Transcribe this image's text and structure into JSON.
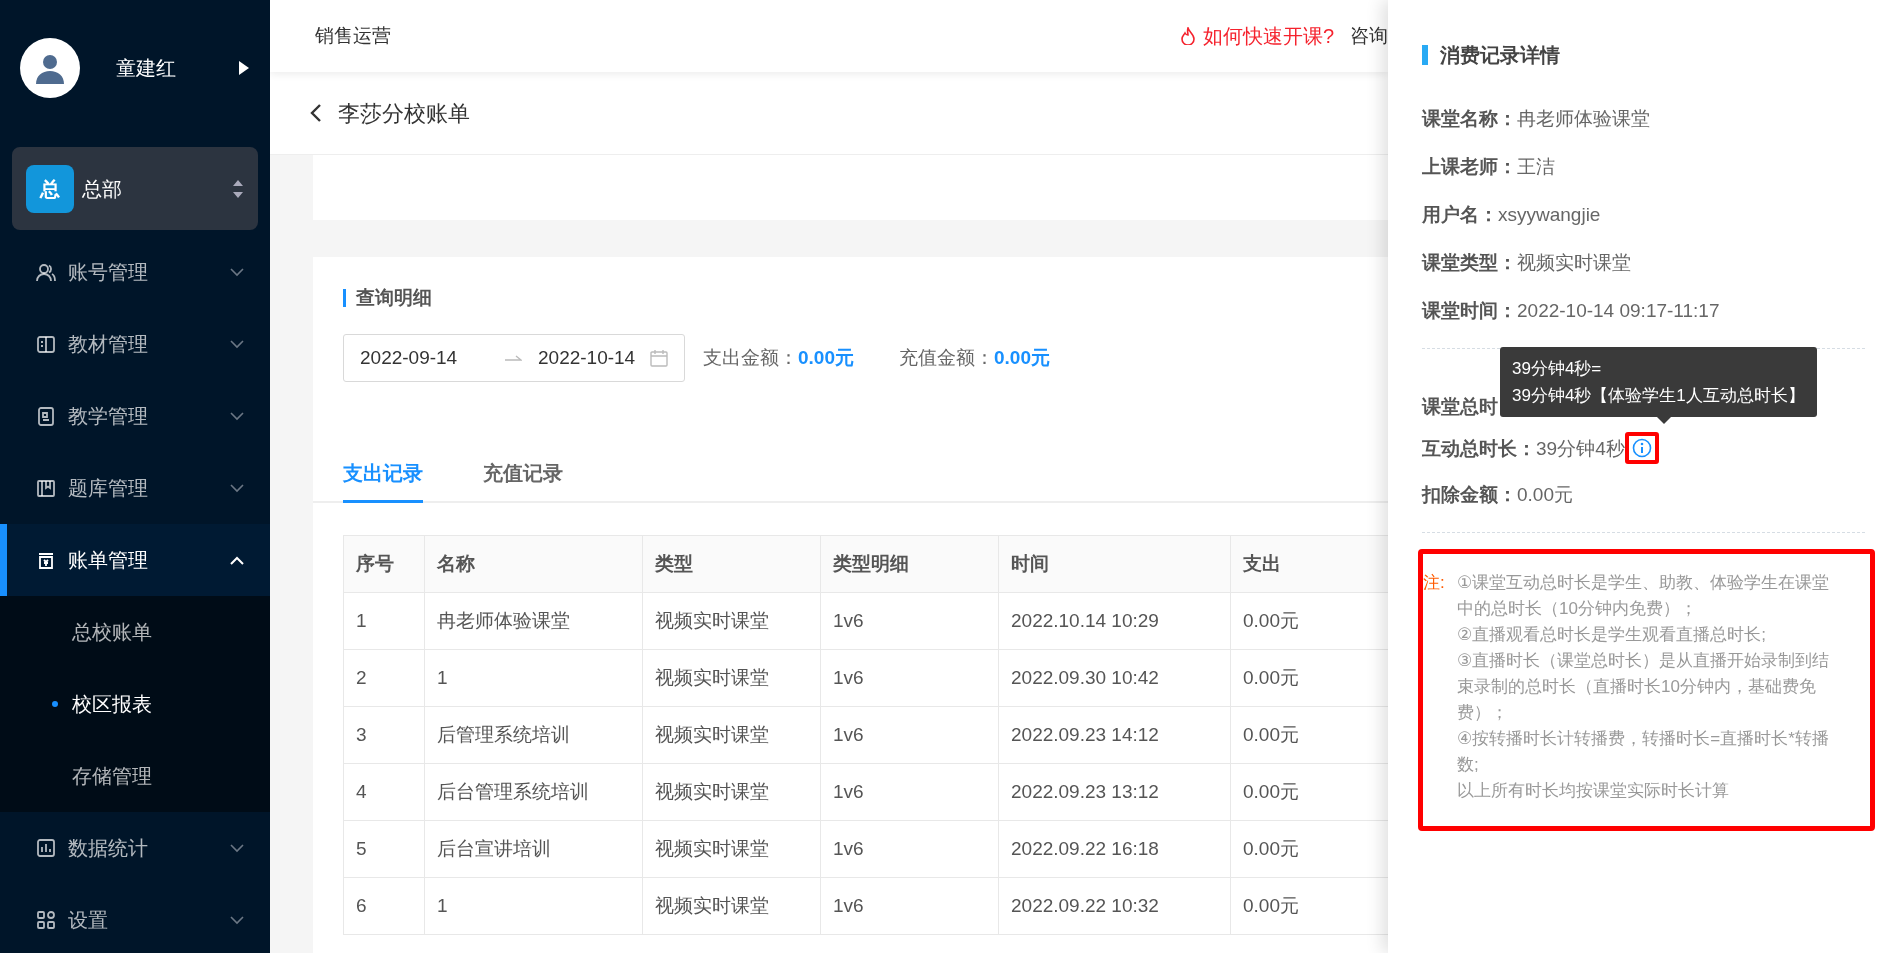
{
  "sidebar": {
    "user": {
      "name": "童建红"
    },
    "org": {
      "badge": "总",
      "name": "总部"
    },
    "menu": [
      {
        "label": "账号管理",
        "kind": "users",
        "selected": false,
        "expanded": false
      },
      {
        "label": "教材管理",
        "kind": "book",
        "selected": false,
        "expanded": false
      },
      {
        "label": "教学管理",
        "kind": "board",
        "selected": false,
        "expanded": false
      },
      {
        "label": "题库管理",
        "kind": "library",
        "selected": false,
        "expanded": false
      },
      {
        "label": "账单管理",
        "kind": "bill",
        "selected": true,
        "expanded": true,
        "children": [
          {
            "label": "总校账单",
            "selected": false
          },
          {
            "label": "校区报表",
            "selected": true
          },
          {
            "label": "存储管理",
            "selected": false
          }
        ]
      },
      {
        "label": "数据统计",
        "kind": "chart",
        "selected": false,
        "expanded": false
      },
      {
        "label": "设置",
        "kind": "grid",
        "selected": false,
        "expanded": false
      }
    ]
  },
  "header": {
    "title": "销售运营",
    "help_link": "如何快速开课?",
    "consult": "咨询"
  },
  "breadcrumb": {
    "title": "李莎分校账单"
  },
  "query": {
    "title": "查询明细",
    "date_from": "2022-09-14",
    "date_to": "2022-10-14",
    "summaries": [
      {
        "label": "支出金额：",
        "value": "0.00元"
      },
      {
        "label": "充值金额：",
        "value": "0.00元"
      }
    ]
  },
  "tabs": [
    {
      "label": "支出记录",
      "selected": true
    },
    {
      "label": "充值记录",
      "selected": false
    }
  ],
  "table": {
    "columns": [
      "序号",
      "名称",
      "类型",
      "类型明细",
      "时间",
      "支出"
    ],
    "rows": [
      [
        "1",
        "冉老师体验课堂",
        "视频实时课堂",
        "1v6",
        "2022.10.14 10:29",
        "0.00元"
      ],
      [
        "2",
        "1",
        "视频实时课堂",
        "1v6",
        "2022.09.30 10:42",
        "0.00元"
      ],
      [
        "3",
        "后管理系统培训",
        "视频实时课堂",
        "1v6",
        "2022.09.23 14:12",
        "0.00元"
      ],
      [
        "4",
        "后台管理系统培训",
        "视频实时课堂",
        "1v6",
        "2022.09.23 13:12",
        "0.00元"
      ],
      [
        "5",
        "后台宣讲培训",
        "视频实时课堂",
        "1v6",
        "2022.09.22 16:18",
        "0.00元"
      ],
      [
        "6",
        "1",
        "视频实时课堂",
        "1v6",
        "2022.09.22 10:32",
        "0.00元"
      ]
    ]
  },
  "detail_panel": {
    "title": "消费记录详情",
    "fields": [
      {
        "label": "课堂名称：",
        "value": "冉老师体验课堂"
      },
      {
        "label": "上课老师：",
        "value": "王洁"
      },
      {
        "label": "用户名：",
        "value": "xsyywangjie"
      },
      {
        "label": "课堂类型：",
        "value": "视频实时课堂"
      },
      {
        "label": "课堂时间：",
        "value": "2022-10-14 09:17-11:17"
      }
    ],
    "durations": [
      {
        "label": "课堂总时"
      },
      {
        "label": "互动总时长：",
        "value": "39分钟4秒",
        "info": true,
        "highlighted": true
      },
      {
        "label": "扣除金额：",
        "value": "0.00元"
      }
    ],
    "tooltip": {
      "lines": [
        "39分钟4秒=",
        "39分钟4秒【体验学生1人互动总时长】"
      ]
    },
    "note": {
      "label": "注:",
      "highlighted": true,
      "lines": [
        "①课堂互动总时长是学生、助教、体验学生在课堂中的总时长（10分钟内免费）；",
        "②直播观看总时长是学生观看直播总时长;",
        "③直播时长（课堂总时长）是从直播开始录制到结束录制的总时长（直播时长10分钟内，基础费免费）；",
        "④按转播时长计转播费，转播时长=直播时长*转播数;",
        "以上所有时长均按课堂实际时长计算"
      ]
    }
  }
}
